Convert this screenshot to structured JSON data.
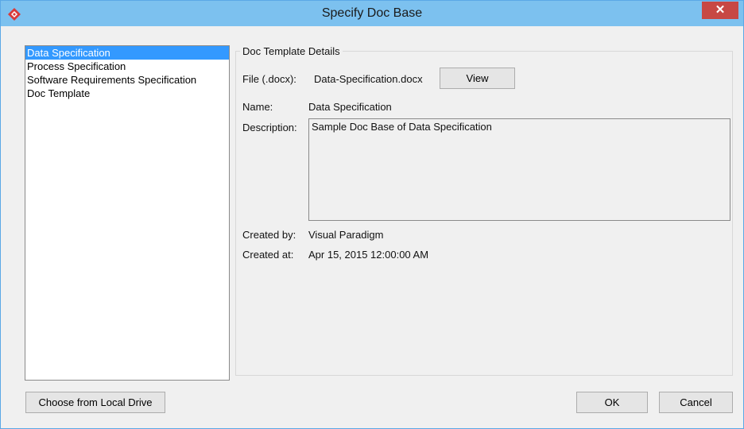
{
  "window": {
    "title": "Specify Doc Base",
    "close_label": "✕",
    "accent": "#7cc1ef",
    "close_color": "#c74844"
  },
  "list": {
    "items": [
      {
        "label": "Data Specification",
        "selected": true
      },
      {
        "label": "Process Specification",
        "selected": false
      },
      {
        "label": "Software Requirements Specification",
        "selected": false
      },
      {
        "label": "Doc Template",
        "selected": false
      }
    ]
  },
  "details": {
    "group_title": "Doc Template Details",
    "file_label": "File (.docx):",
    "file_value": "Data-Specification.docx",
    "view_button": "View",
    "name_label": "Name:",
    "name_value": "Data Specification",
    "description_label": "Description:",
    "description_value": "Sample Doc Base of Data Specification",
    "created_by_label": "Created by:",
    "created_by_value": "Visual Paradigm",
    "created_at_label": "Created at:",
    "created_at_value": "Apr 15, 2015 12:00:00 AM"
  },
  "footer": {
    "local_drive_button": "Choose from Local Drive",
    "ok_button": "OK",
    "cancel_button": "Cancel"
  }
}
